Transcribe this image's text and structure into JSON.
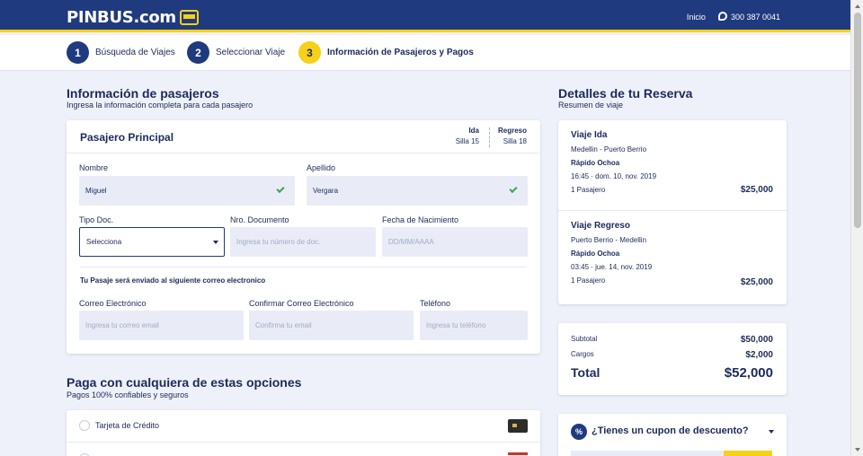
{
  "header": {
    "logo_text": "PINBUS.com",
    "inicio": "Inicio",
    "phone": "300 387 0041"
  },
  "steps": [
    {
      "number": "1",
      "label": "Búsqueda de Viajes",
      "active": false
    },
    {
      "number": "2",
      "label": "Seleccionar Viaje",
      "active": false
    },
    {
      "number": "3",
      "label": "Información de Pasajeros y Pagos",
      "active": true
    }
  ],
  "passengers": {
    "title": "Información de pasajeros",
    "subtitle": "Ingresa la información completa para cada pasajero",
    "card_title": "Pasajero Principal",
    "ida_label": "Ida",
    "ida_seat": "Silla 15",
    "regreso_label": "Regreso",
    "regreso_seat": "Silla 18",
    "nombre_label": "Nombre",
    "nombre_value": "Miguel",
    "apellido_label": "Apellido",
    "apellido_value": "Vergara",
    "tipo_doc_label": "Tipo Doc.",
    "tipo_doc_value": "Selecciona",
    "nro_doc_label": "Nro. Documento",
    "nro_doc_placeholder": "Ingresa tu número de doc.",
    "fecha_label": "Fecha de Nacimiento",
    "fecha_placeholder": "DD/MM/AAAA",
    "email_note": "Tu Pasaje será enviado al siguiente correo electronico",
    "correo_label": "Correo Electrónico",
    "correo_placeholder": "Ingresa tu correo email",
    "confirmar_label": "Confirmar Correo Electrónico",
    "confirmar_placeholder": "Confirma tu email",
    "telefono_label": "Teléfono",
    "telefono_placeholder": "Ingresa tu teléfono"
  },
  "payment": {
    "title": "Paga con cualquiera de estas opciones",
    "subtitle": "Pagos 100% confiables y seguros",
    "options": [
      {
        "label": "Tarjeta de Crédito",
        "icon": "credit-card-icon"
      }
    ]
  },
  "reservation": {
    "title": "Detalles de tu Reserva",
    "subtitle": "Resumen de viaje",
    "ida": {
      "name": "Viaje Ida",
      "route": "Medellin - Puerto Berrio",
      "company": "Rápido Ochoa",
      "datetime": "16:45 · dom. 10, nov. 2019",
      "passengers": "1 Pasajero",
      "price": "$25,000"
    },
    "regreso": {
      "name": "Viaje Regreso",
      "route": "Puerto Berrio - Medellin",
      "company": "Rápido Ochoa",
      "datetime": "03:45 · jue. 14, nov. 2019",
      "passengers": "1 Pasajero",
      "price": "$25,000"
    }
  },
  "summary": {
    "subtotal_label": "Subtotal",
    "subtotal": "$50,000",
    "cargos_label": "Cargos",
    "cargos": "$2,000",
    "total_label": "Total",
    "total": "$52,000"
  },
  "coupon": {
    "icon_text": "%",
    "question": "¿Tienes un cupon de descuento?"
  },
  "colors": {
    "navy": "#1f3a7e",
    "yellow": "#f7d117",
    "background": "#eef1f9",
    "success": "#3aa652"
  }
}
